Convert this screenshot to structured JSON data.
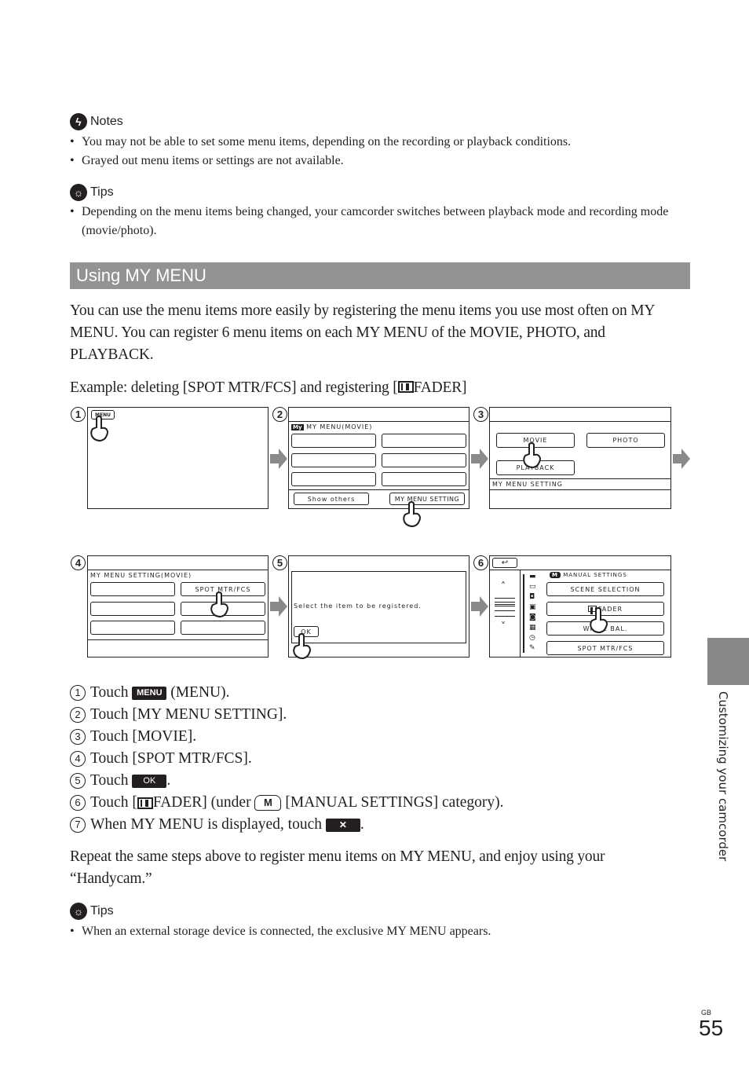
{
  "notes": {
    "heading": "Notes",
    "items": [
      "You may not be able to set some menu items, depending on the recording or playback conditions.",
      "Grayed out menu items or settings are not available."
    ]
  },
  "tips1": {
    "heading": "Tips",
    "items": [
      "Depending on the menu items being changed, your camcorder switches between playback mode and recording mode (movie/photo)."
    ]
  },
  "section": {
    "title": "Using MY MENU"
  },
  "intro": "You can use the menu items more easily by registering the menu items you use most often on MY MENU. You can register 6 menu items on each MY MENU of the MOVIE, PHOTO, and PLAYBACK.",
  "example": {
    "prefix": "Example: deleting [SPOT MTR/FCS] and registering [",
    "suffix": "FADER]"
  },
  "screens": {
    "s1": {
      "num": "1",
      "menu_button": "MENU"
    },
    "s2": {
      "num": "2",
      "my_badge": "My",
      "title": "MY MENU(MOVIE)",
      "show_others": "Show others",
      "my_menu_setting": "MY MENU SETTING"
    },
    "s3": {
      "num": "3",
      "movie": "MOVIE",
      "photo": "PHOTO",
      "playback": "PLAYBACK",
      "footer": "MY MENU SETTING"
    },
    "s4": {
      "num": "4",
      "title": "MY MENU SETTING(MOVIE)",
      "spot": "SPOT MTR/FCS"
    },
    "s5": {
      "num": "5",
      "message": "Select the item to be registered.",
      "ok": "OK"
    },
    "s6": {
      "num": "6",
      "category_badge": "M",
      "category": "MANUAL SETTINGS",
      "items": [
        "SCENE SELECTION",
        "FADER",
        "WHITE BAL.",
        "SPOT MTR/FCS"
      ]
    }
  },
  "steps": [
    {
      "num": "1",
      "pre": "Touch",
      "badge": "MENU",
      "post": "(MENU)."
    },
    {
      "num": "2",
      "text": "Touch [MY MENU SETTING]."
    },
    {
      "num": "3",
      "text": "Touch [MOVIE]."
    },
    {
      "num": "4",
      "text": "Touch [SPOT MTR/FCS]."
    },
    {
      "num": "5",
      "pre": "Touch",
      "badge": "OK",
      "post": "."
    },
    {
      "num": "6",
      "pre": "Touch [",
      "mid": "FADER] (under",
      "m_badge": "M",
      "post": "[MANUAL SETTINGS] category)."
    },
    {
      "num": "7",
      "pre": "When MY MENU is displayed, touch",
      "badge": "✕",
      "post": "."
    }
  ],
  "repeat": "Repeat the same steps above to register menu items on MY MENU, and enjoy using your “Handycam.”",
  "tips2": {
    "heading": "Tips",
    "items": [
      "When an external storage device is connected, the exclusive MY MENU appears."
    ]
  },
  "side_label": "Customizing your camcorder",
  "page": {
    "region": "GB",
    "number": "55"
  }
}
